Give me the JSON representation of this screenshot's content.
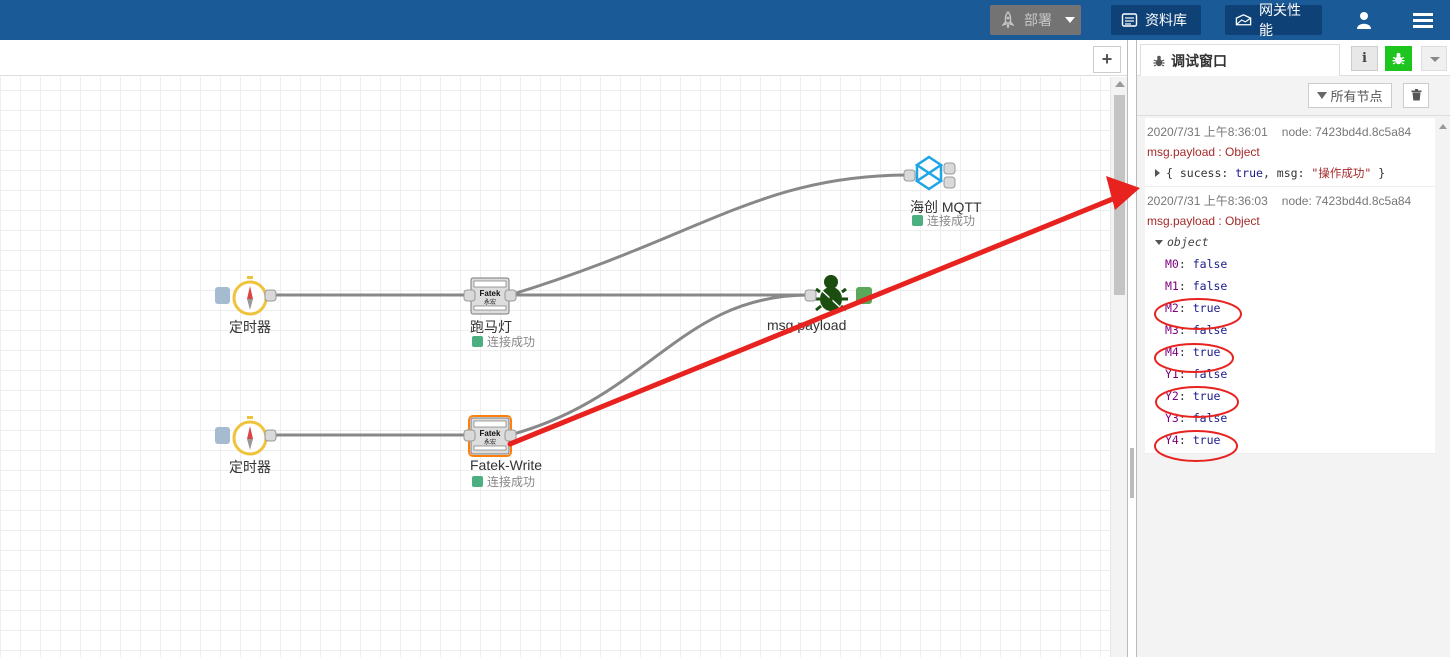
{
  "header": {
    "deploy_label": "部署",
    "library_label": "资料库",
    "performance_label": "网关性能",
    "brand_color": "#1a5a96"
  },
  "workspace": {
    "add_tab_label": "+"
  },
  "nodes": {
    "timer1_label": "定时器",
    "timer2_label": "定时器",
    "fatek1_label": "跑马灯",
    "fatek1_status": "连接成功",
    "fatek2_label": "Fatek-Write",
    "fatek2_status": "连接成功",
    "mqtt_label": "海创 MQTT",
    "mqtt_status": "连接成功",
    "debug_label": "msg.payload",
    "fatek_icon_text": "Fatek",
    "fatek_icon_sub": "永宏"
  },
  "sidebar": {
    "tab_label": "调试窗口",
    "info_icon": "i",
    "filter_label": "所有节点",
    "messages": [
      {
        "time": "2020/7/31 上午8:36:01",
        "node": "node: 7423bd4d.8c5a84",
        "topic": "msg.payload : Object",
        "summary_open": "{ sucess: ",
        "summary_true": "true",
        "summary_mid": ", msg: ",
        "summary_str": "\"操作成功\"",
        "summary_close": " }"
      },
      {
        "time": "2020/7/31 上午8:36:03",
        "node": "node: 7423bd4d.8c5a84",
        "topic": "msg.payload : Object",
        "object_label": "object",
        "props": [
          {
            "key": "M0",
            "value": "false"
          },
          {
            "key": "M1",
            "value": "false"
          },
          {
            "key": "M2",
            "value": "true"
          },
          {
            "key": "M3",
            "value": "false"
          },
          {
            "key": "M4",
            "value": "true"
          },
          {
            "key": "Y1",
            "value": "false"
          },
          {
            "key": "Y2",
            "value": "true"
          },
          {
            "key": "Y3",
            "value": "false"
          },
          {
            "key": "Y4",
            "value": "true"
          }
        ]
      }
    ]
  },
  "colors": {
    "annotation_red": "#e8231f",
    "status_green": "#4caf7f",
    "debug_green": "#1ec51e"
  }
}
